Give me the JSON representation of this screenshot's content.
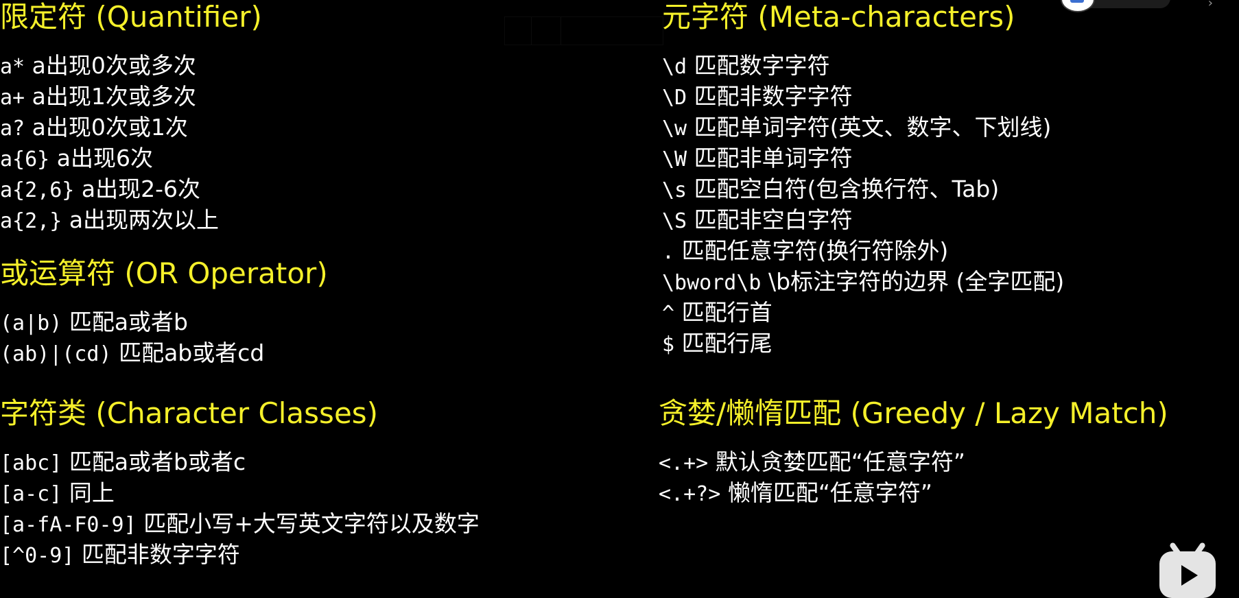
{
  "sections": {
    "quantifier": {
      "title": "限定符 (Quantifier)",
      "items": [
        {
          "code": "a*",
          "desc": "a出现0次或多次"
        },
        {
          "code": "a+",
          "desc": "a出现1次或多次"
        },
        {
          "code": "a?",
          "desc": "a出现0次或1次"
        },
        {
          "code": "a{6}",
          "desc": "a出现6次"
        },
        {
          "code": "a{2,6}",
          "desc": "a出现2-6次"
        },
        {
          "code": "a{2,}",
          "desc": "a出现两次以上"
        }
      ]
    },
    "meta": {
      "title": "元字符 (Meta-characters)",
      "items": [
        {
          "code": "\\d",
          "desc": "匹配数字字符"
        },
        {
          "code": "\\D",
          "desc": "匹配非数字字符"
        },
        {
          "code": "\\w",
          "desc": "匹配单词字符(英文、数字、下划线)"
        },
        {
          "code": "\\W",
          "desc": "匹配非单词字符"
        },
        {
          "code": "\\s",
          "desc": "匹配空白符(包含换行符、Tab)"
        },
        {
          "code": "\\S",
          "desc": "匹配非空白字符"
        },
        {
          "code": ".",
          "desc": "匹配任意字符(换行符除外)"
        },
        {
          "code": "\\bword\\b",
          "desc": "\\b标注字符的边界 (全字匹配)"
        },
        {
          "code": "^",
          "desc": "匹配行首"
        },
        {
          "code": "$",
          "desc": "匹配行尾"
        }
      ]
    },
    "or": {
      "title": "或运算符 (OR Operator)",
      "items": [
        {
          "code": "(a|b)",
          "desc": "匹配a或者b"
        },
        {
          "code": "(ab)|(cd)",
          "desc": "匹配ab或者cd"
        }
      ]
    },
    "classes": {
      "title": "字符类 (Character Classes)",
      "items": [
        {
          "code": "[abc]",
          "desc": "匹配a或者b或者c"
        },
        {
          "code": "[a-c]",
          "desc": "同上"
        },
        {
          "code": "[a-fA-F0-9]",
          "desc": "匹配小写+大写英文字符以及数字"
        },
        {
          "code": "[^0-9]",
          "desc": "匹配非数字字符"
        }
      ]
    },
    "greedy": {
      "title": "贪婪/懒惰匹配 (Greedy / Lazy Match)",
      "items": [
        {
          "code": "<.+>",
          "desc": "默认贪婪匹配“任意字符”"
        },
        {
          "code": "<.+?>",
          "desc": "懒惰匹配“任意字符”"
        }
      ]
    }
  },
  "overlay": {
    "play_icon": "bilibili-play-icon",
    "avatar_icon": "avatar-icon"
  },
  "colors": {
    "background": "#000000",
    "heading": "#f5f02a",
    "text": "#ffffff"
  }
}
